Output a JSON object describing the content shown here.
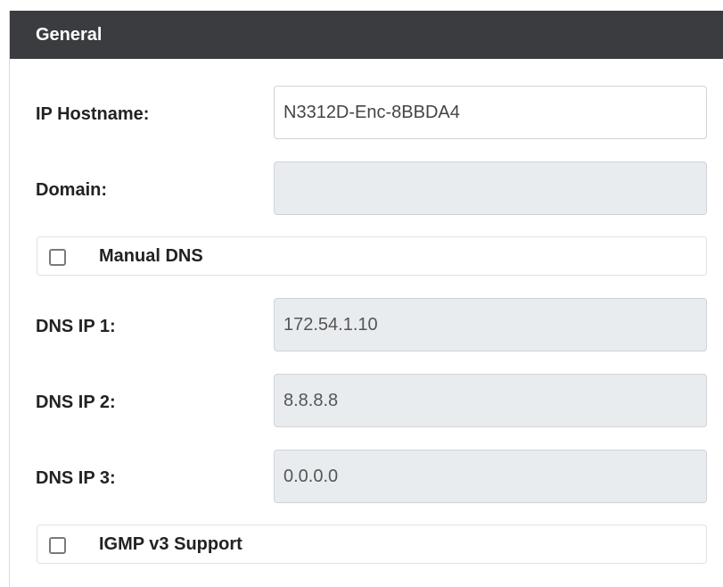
{
  "panel": {
    "title": "General"
  },
  "hostname": {
    "label": "IP Hostname:",
    "value": "N3312D-Enc-8BBDA4",
    "disabled": false
  },
  "domain": {
    "label": "Domain:",
    "value": "",
    "disabled": true
  },
  "manual_dns": {
    "label": "Manual DNS",
    "checked": false
  },
  "dns1": {
    "label": "DNS IP 1:",
    "value": "172.54.1.10",
    "disabled": true
  },
  "dns2": {
    "label": "DNS IP 2:",
    "value": "8.8.8.8",
    "disabled": true
  },
  "dns3": {
    "label": "DNS IP 3:",
    "value": "0.0.0.0",
    "disabled": true
  },
  "igmp": {
    "label": "IGMP v3 Support",
    "checked": false
  },
  "colors": {
    "header_bg": "#3a3c40",
    "disabled_field_bg": "#e9ecef",
    "border": "#cfd3d7"
  }
}
